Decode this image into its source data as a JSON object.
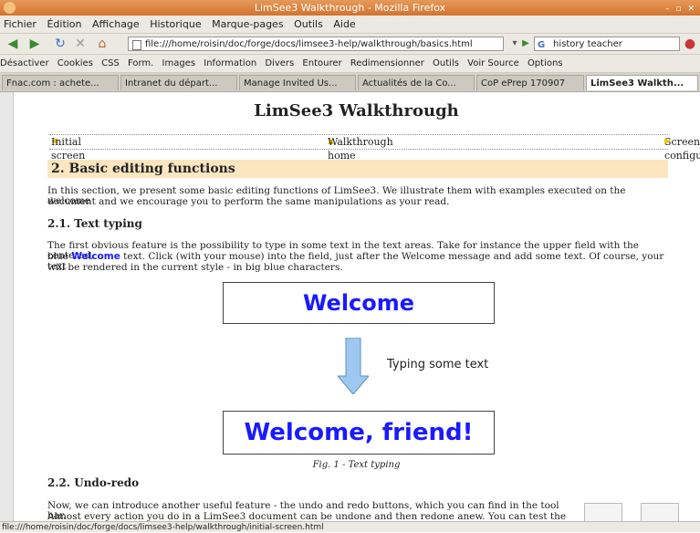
{
  "window": {
    "title": "LimSee3 Walkthrough - Mozilla Firefox"
  },
  "menu": [
    "Fichier",
    "Édition",
    "Affichage",
    "Historique",
    "Marque-pages",
    "Outils",
    "Aide"
  ],
  "nav": {
    "url": "file:///home/roisin/doc/forge/docs/limsee3-help/walkthrough/basics.html",
    "search_value": "history teacher"
  },
  "toolbar": [
    "Désactiver",
    "Cookies",
    "CSS",
    "Form.",
    "Images",
    "Information",
    "Divers",
    "Entourer",
    "Redimensionner",
    "Outils",
    "Voir Source",
    "Options"
  ],
  "tabs": [
    "Fnac.com : achete...",
    "Intranet du départ...",
    "Manage Invited Us...",
    "Actualités de la Co...",
    "CoP ePrep 170907",
    "LimSee3 Walkth..."
  ],
  "page": {
    "title": "LimSee3 Walkthrough",
    "nav_prev": "Initial screen",
    "nav_home": "Walkthrough home",
    "nav_next": "Screen configuration",
    "section_title": "2. Basic editing functions",
    "intro_1": "In this section, we present some basic editing functions of LimSee3. We illustrate them with examples executed on the welcome",
    "intro_2": "document and we encourage you to perform the same manipulations as your read.",
    "sub1_title": "2.1. Text typing",
    "p1_line1": "The first obvious feature is the possibility to type in some text in the text areas. Take for instance the upper field with the centered,",
    "p1_line2_a": "blue ",
    "p1_line2_b": "Welcome",
    "p1_line2_c": " text. Click (with your mouse) into the field, just after the Welcome message and add some text. Of course, your text",
    "p1_line3": "will be rendered in the current style - in big blue characters.",
    "fig_top": "Welcome",
    "fig_arrow_label": "Typing some text",
    "fig_bottom": "Welcome, friend!",
    "fig_caption": "Fig. 1 - Text typing",
    "sub2_title": "2.2. Undo-redo",
    "p2_line1": "Now, we can introduce another useful feature - the undo and redo buttons, which you can find in the tool bar.",
    "p2_line2": "Almost every action you do in a LimSee3 document can be undone and then redone anew. You can test the"
  },
  "status": {
    "text": "file:///home/roisin/doc/forge/docs/limsee3-help/walkthrough/initial-screen.html"
  }
}
